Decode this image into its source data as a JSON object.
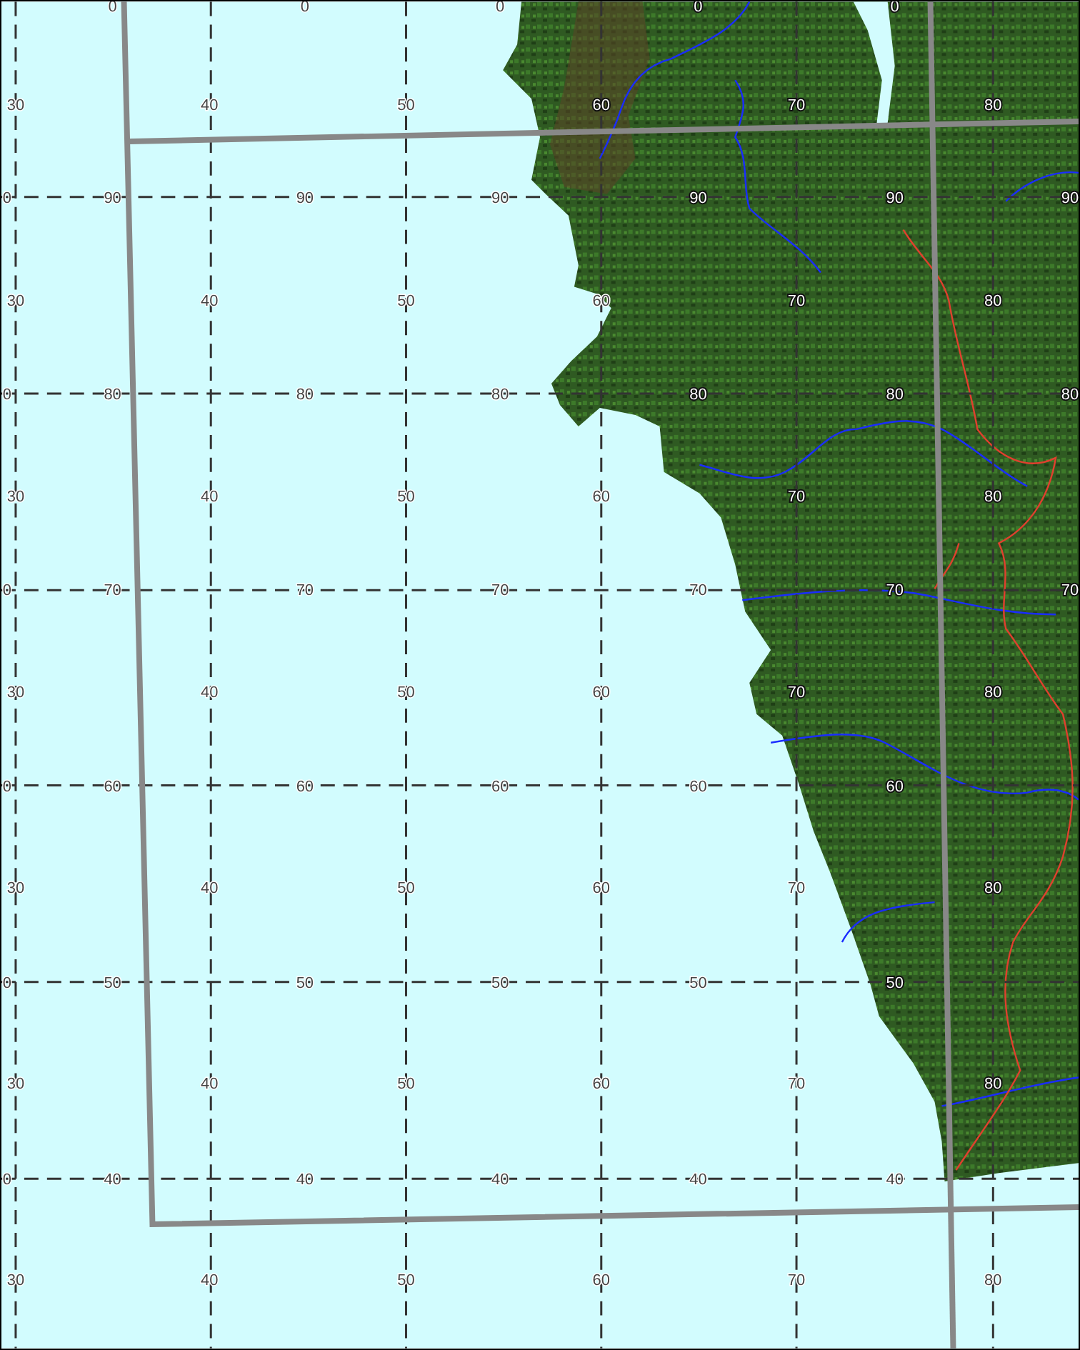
{
  "map": {
    "label_rows": [
      {
        "kind": "top",
        "labels": [
          "0",
          "0",
          "0",
          "0",
          "0"
        ]
      },
      {
        "kind": "mid",
        "labels": [
          "30",
          "40",
          "50",
          "60",
          "70",
          "80"
        ]
      },
      {
        "kind": "line",
        "labels": [
          "0",
          "90",
          "90",
          "90",
          "90",
          "90",
          "90"
        ]
      },
      {
        "kind": "mid",
        "labels": [
          "30",
          "40",
          "50",
          "60",
          "70",
          "80"
        ]
      },
      {
        "kind": "line",
        "labels": [
          "0",
          "80",
          "80",
          "80",
          "80",
          "80",
          "80"
        ]
      },
      {
        "kind": "mid",
        "labels": [
          "30",
          "40",
          "50",
          "60",
          "70",
          "80"
        ]
      },
      {
        "kind": "line",
        "labels": [
          "0",
          "70",
          "70",
          "70",
          "70",
          "70",
          "70"
        ]
      },
      {
        "kind": "mid",
        "labels": [
          "30",
          "40",
          "50",
          "60",
          "70",
          "80"
        ]
      },
      {
        "kind": "line",
        "labels": [
          "0",
          "60",
          "60",
          "60",
          "60",
          "60"
        ]
      },
      {
        "kind": "mid",
        "labels": [
          "30",
          "40",
          "50",
          "60",
          "70",
          "80"
        ]
      },
      {
        "kind": "line",
        "labels": [
          "0",
          "50",
          "50",
          "50",
          "50",
          "50"
        ]
      },
      {
        "kind": "mid",
        "labels": [
          "30",
          "40",
          "50",
          "60",
          "70",
          "80"
        ]
      },
      {
        "kind": "line",
        "labels": [
          "0",
          "40",
          "40",
          "40",
          "40",
          "40"
        ]
      },
      {
        "kind": "mid",
        "labels": [
          "30",
          "40",
          "50",
          "60",
          "70",
          "80"
        ]
      }
    ]
  }
}
